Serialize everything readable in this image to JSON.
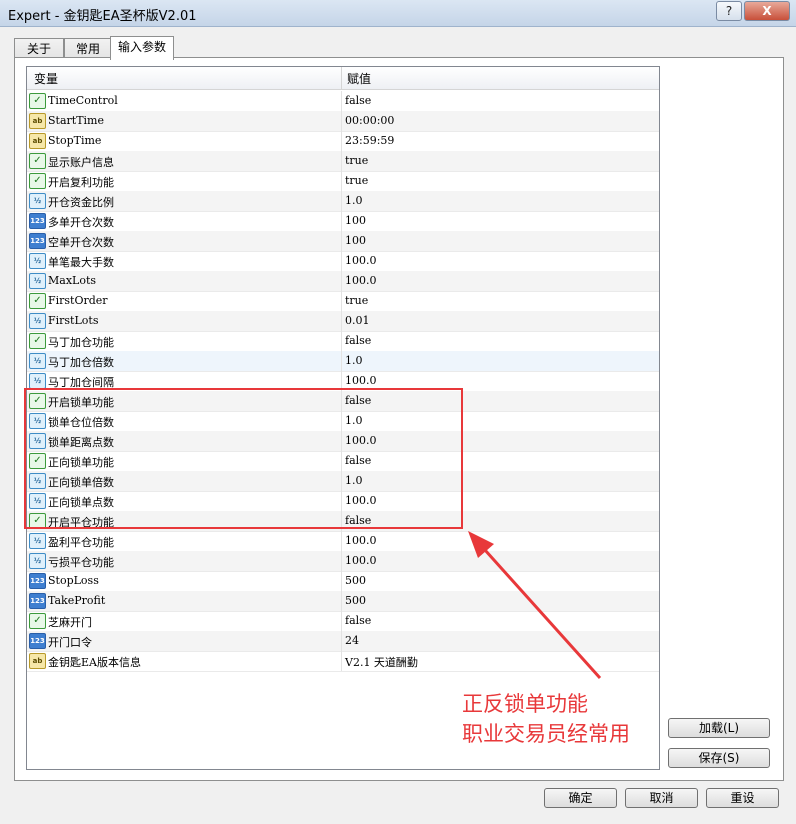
{
  "window": {
    "title": "Expert - 金钥匙EA圣杯版V2.01",
    "help_label": "?",
    "close_label": "X"
  },
  "tabs": [
    {
      "label": "关于"
    },
    {
      "label": "常用"
    },
    {
      "label": "输入参数"
    }
  ],
  "grid": {
    "headers": {
      "variable": "变量",
      "value": "赋值"
    },
    "rows": [
      {
        "icon": "bool",
        "name": "TimeControl",
        "value": "false"
      },
      {
        "icon": "string",
        "name": "StartTime",
        "value": "00:00:00"
      },
      {
        "icon": "string",
        "name": "StopTime",
        "value": "23:59:59"
      },
      {
        "icon": "bool",
        "name": "显示账户信息",
        "value": "true"
      },
      {
        "icon": "bool",
        "name": "开启复利功能",
        "value": "true"
      },
      {
        "icon": "double",
        "name": "开仓资金比例",
        "value": "1.0"
      },
      {
        "icon": "int",
        "name": "多单开仓次数",
        "value": "100"
      },
      {
        "icon": "int",
        "name": "空单开仓次数",
        "value": "100"
      },
      {
        "icon": "double",
        "name": "单笔最大手数",
        "value": "100.0"
      },
      {
        "icon": "double",
        "name": "MaxLots",
        "value": "100.0"
      },
      {
        "icon": "bool",
        "name": "FirstOrder",
        "value": "true"
      },
      {
        "icon": "double",
        "name": "FirstLots",
        "value": "0.01"
      },
      {
        "icon": "bool",
        "name": "马丁加仓功能",
        "value": "false"
      },
      {
        "icon": "double",
        "name": "马丁加仓倍数",
        "value": "1.0"
      },
      {
        "icon": "double",
        "name": "马丁加仓间隔",
        "value": "100.0"
      },
      {
        "icon": "bool",
        "name": "开启锁单功能",
        "value": "false"
      },
      {
        "icon": "double",
        "name": "锁单仓位倍数",
        "value": "1.0"
      },
      {
        "icon": "double",
        "name": "锁单距离点数",
        "value": "100.0"
      },
      {
        "icon": "bool",
        "name": "正向锁单功能",
        "value": "false"
      },
      {
        "icon": "double",
        "name": "正向锁单倍数",
        "value": "1.0"
      },
      {
        "icon": "double",
        "name": "正向锁单点数",
        "value": "100.0"
      },
      {
        "icon": "bool",
        "name": "开启平仓功能",
        "value": "false"
      },
      {
        "icon": "double",
        "name": "盈利平仓功能",
        "value": "100.0"
      },
      {
        "icon": "double",
        "name": "亏损平仓功能",
        "value": "100.0"
      },
      {
        "icon": "int",
        "name": "StopLoss",
        "value": "500"
      },
      {
        "icon": "int",
        "name": "TakeProfit",
        "value": "500"
      },
      {
        "icon": "bool",
        "name": "芝麻开门",
        "value": "false"
      },
      {
        "icon": "int",
        "name": "开门口令",
        "value": "24"
      },
      {
        "icon": "string",
        "name": "金钥匙EA版本信息",
        "value": "V2.1 天道酬勤"
      }
    ]
  },
  "annotation": {
    "line1": "正反锁单功能",
    "line2": "职业交易员经常用",
    "color": "#e8383a"
  },
  "buttons": {
    "load": "加载(L)",
    "save": "保存(S)",
    "ok": "确定",
    "cancel": "取消",
    "reset": "重设"
  },
  "icons": {
    "bool": "checkmark-icon",
    "string": "ab-icon",
    "double": "half-icon",
    "int": "123-icon"
  }
}
